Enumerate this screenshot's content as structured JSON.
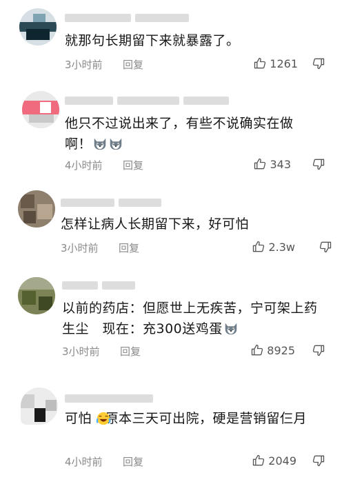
{
  "comments": [
    {
      "text": "就那句长期留下来就暴露了。",
      "time": "3小时前",
      "reply_label": "回复",
      "likes": "1261",
      "emoji": ""
    },
    {
      "text": "他只不过说出来了，有些不说确实在做啊！",
      "time": "4小时前",
      "reply_label": "回复",
      "likes": "343",
      "emoji": "husky-face-icon x2"
    },
    {
      "text": "怎样让病人长期留下来，好可怕",
      "time": "3小时前",
      "reply_label": "回复",
      "likes": "2.3w",
      "emoji": ""
    },
    {
      "text": "以前的药店：但愿世上无疾苦，宁可架上药生尘　现在：充300送鸡蛋",
      "time": "3小时前",
      "reply_label": "回复",
      "likes": "8925",
      "emoji": "husky-face-icon"
    },
    {
      "text": "可怕　原本三天可出院，硬是营销留仨月",
      "time": "4小时前",
      "reply_label": "回复",
      "likes": "2049",
      "emoji": "laughing-crying-face-icon"
    }
  ],
  "colors": {
    "meta_text": "#8a8a8a",
    "body_text": "#161616",
    "icon": "#555555"
  }
}
